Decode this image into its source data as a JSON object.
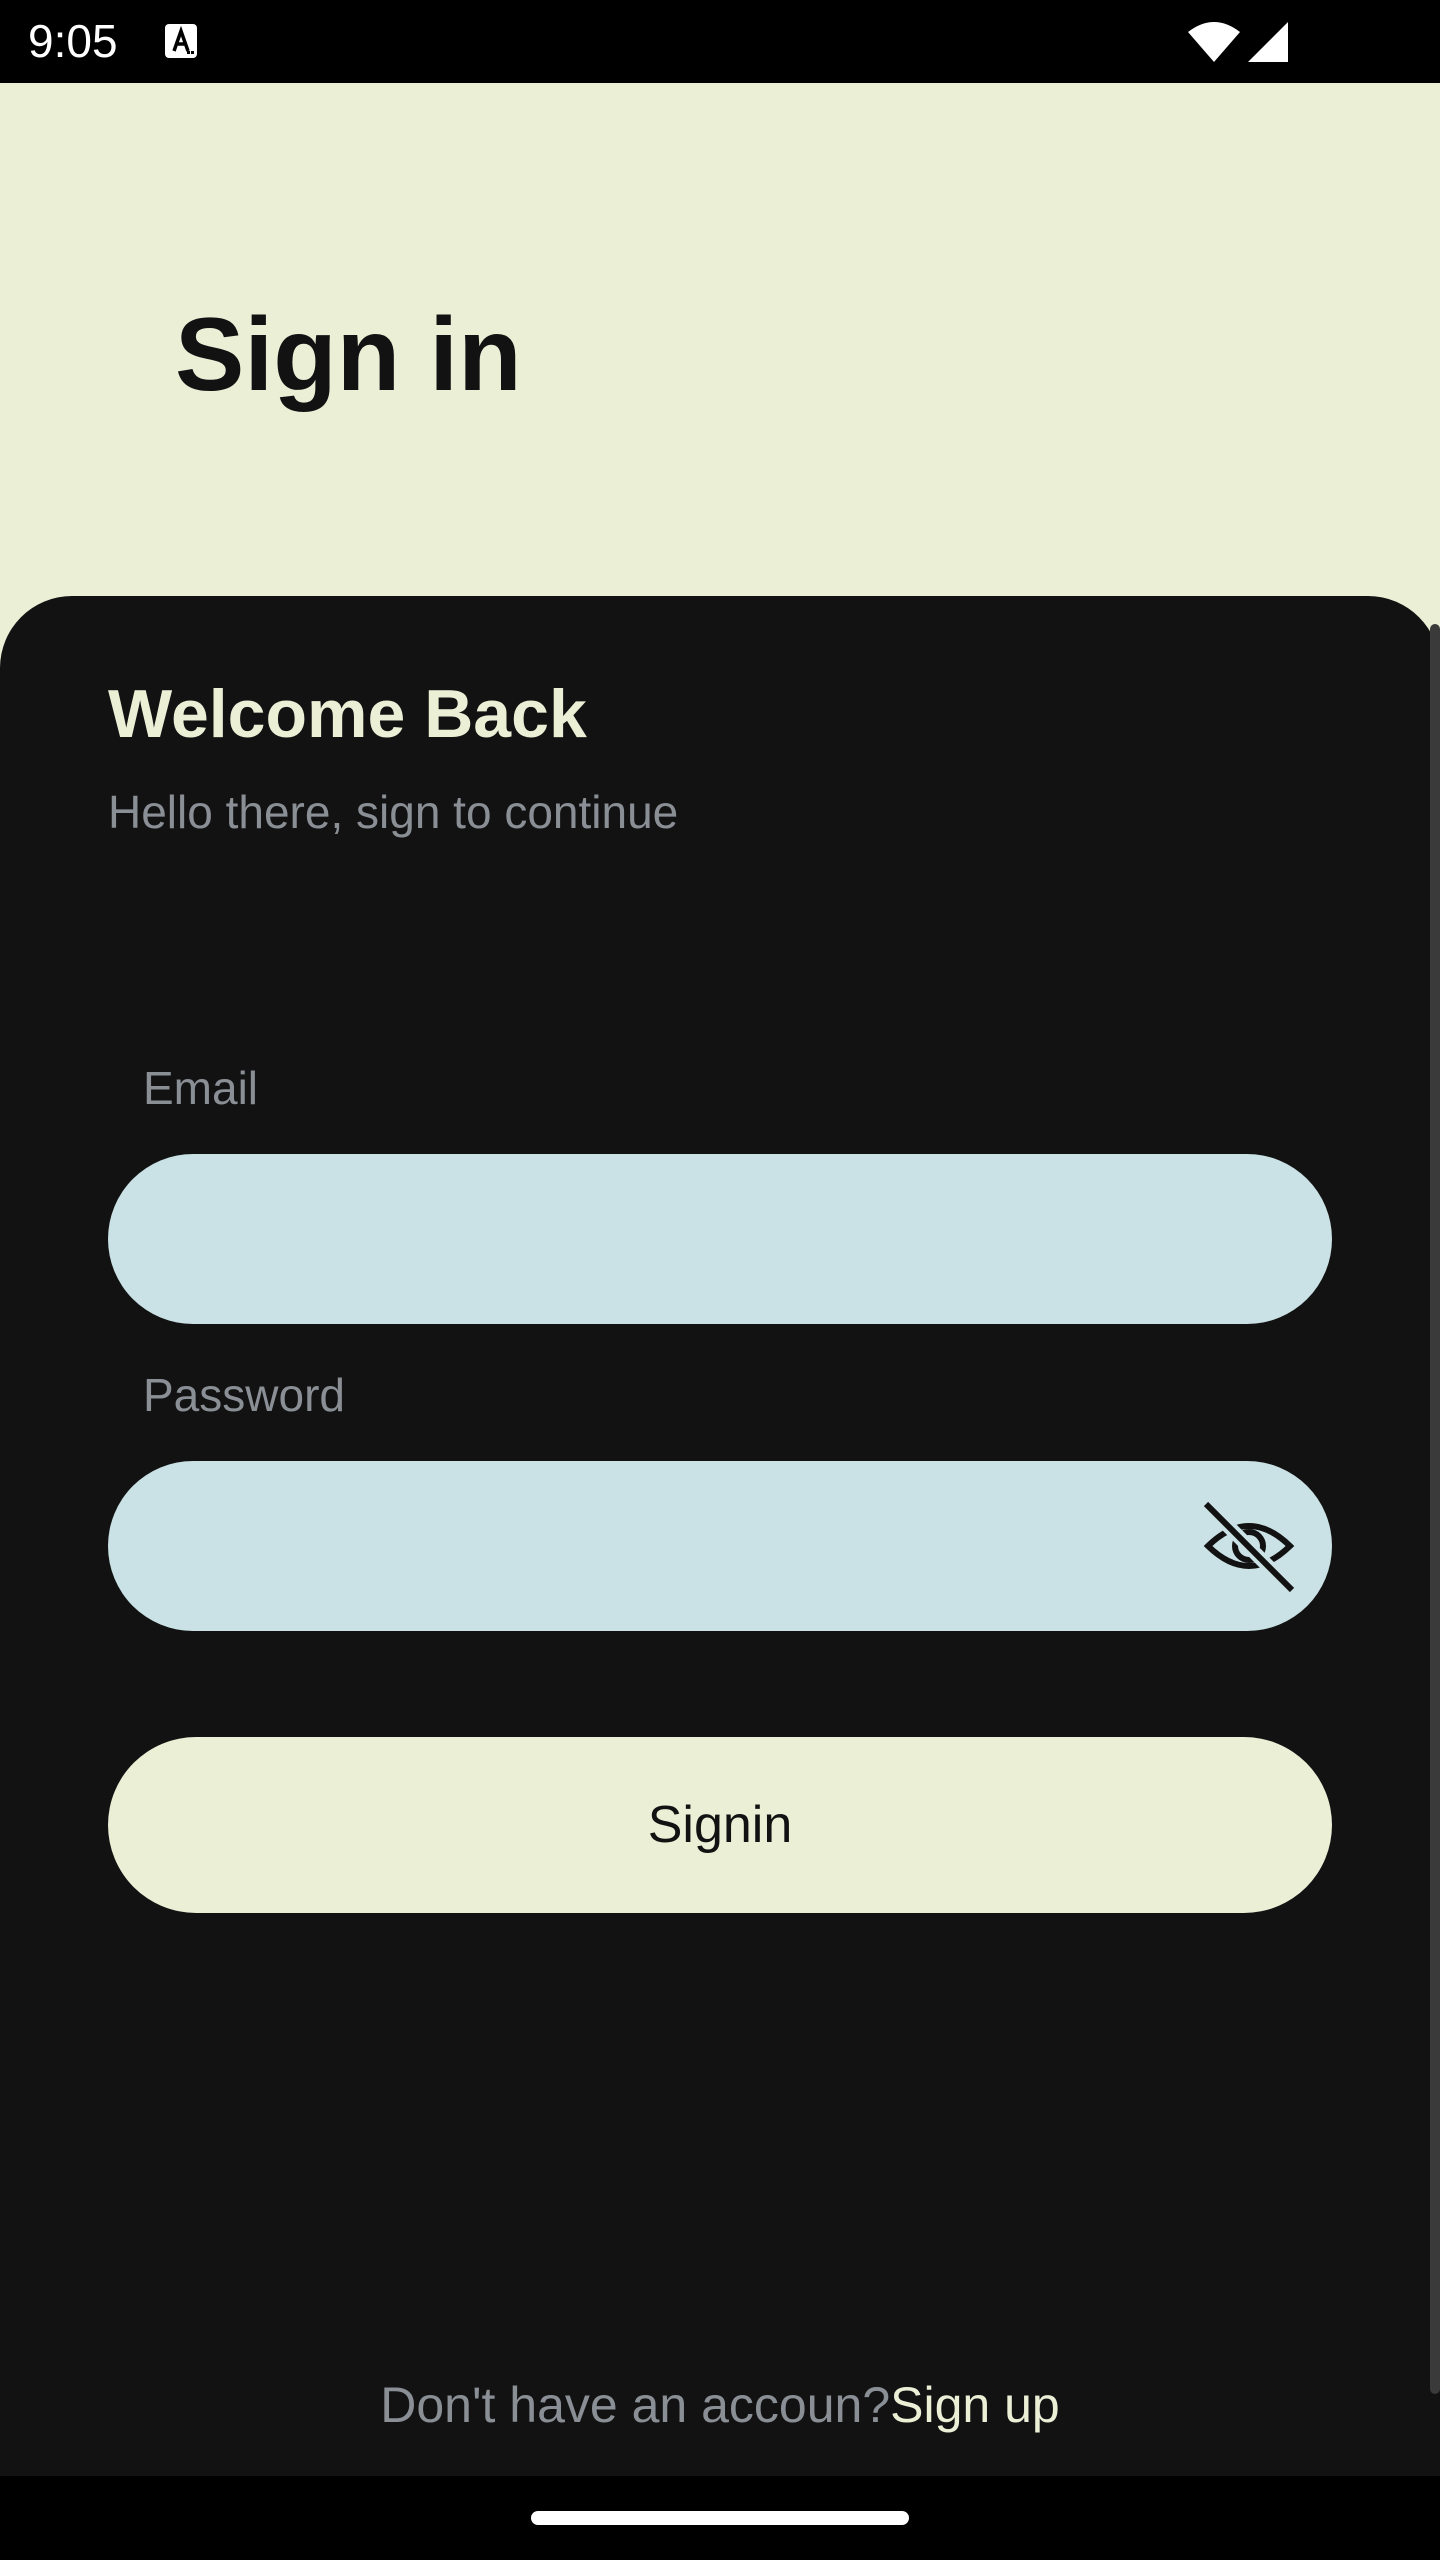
{
  "status_bar": {
    "time": "9:05",
    "notification_icon": "font-a-icon",
    "wifi_icon": "wifi-icon",
    "signal_icon": "cell-signal-icon"
  },
  "header": {
    "title": "Sign in"
  },
  "card": {
    "welcome_title": "Welcome Back",
    "welcome_subtitle": "Hello there, sign to continue"
  },
  "form": {
    "email_label": "Email",
    "email_value": "",
    "password_label": "Password",
    "password_value": "",
    "password_toggle_icon": "visibility-off-icon",
    "submit_label": "Signin"
  },
  "footer": {
    "signup_prompt": "Don't have an accoun?",
    "signup_link": "Sign up"
  },
  "colors": {
    "background_light": "#EBEFD6",
    "card_dark": "#121212",
    "input_fill": "#CAE2E5",
    "muted_text": "#8A8F96"
  }
}
